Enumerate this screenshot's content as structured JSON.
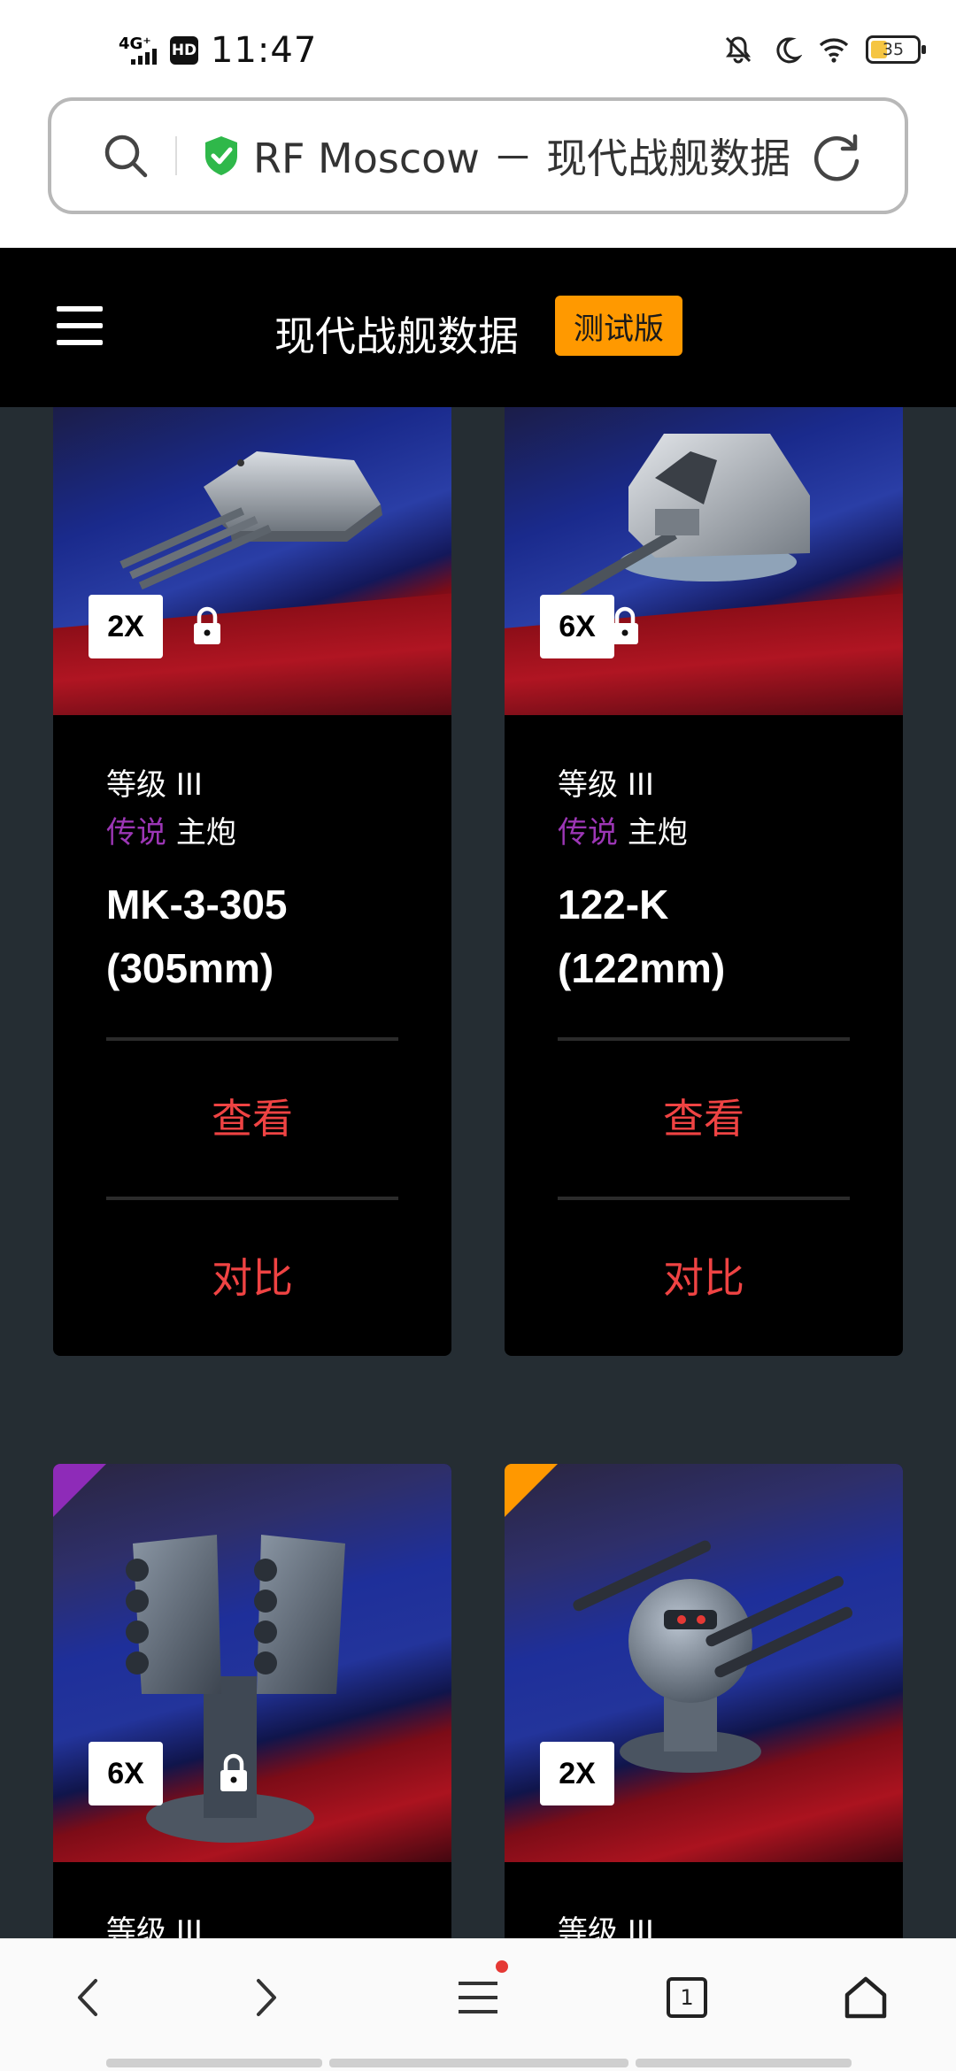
{
  "status_bar": {
    "network": "4G⁺",
    "hd": "HD",
    "time": "11:47",
    "battery": "35"
  },
  "address_bar": {
    "url_text": "RF Moscow － 现代战舰数据",
    "icons": [
      "search-icon",
      "shield-check-icon",
      "reload-icon"
    ]
  },
  "site_header": {
    "title": "现代战舰数据",
    "badge": "测试版"
  },
  "cards": [
    {
      "multiplier": "2X",
      "locked": true,
      "tier": "等级 III",
      "rarity": "传说",
      "weapon_type": "主炮",
      "name_line1": "MK-3-305",
      "name_line2": "(305mm)",
      "view_label": "查看",
      "compare_label": "对比"
    },
    {
      "multiplier": "6X",
      "locked": true,
      "tier": "等级 III",
      "rarity": "传说",
      "weapon_type": "主炮",
      "name_line1": "122-K",
      "name_line2": "(122mm)",
      "view_label": "查看",
      "compare_label": "对比"
    },
    {
      "multiplier": "6X",
      "locked": true,
      "tier": "等级 III",
      "corner_color": "#8e2bb8"
    },
    {
      "multiplier": "2X",
      "locked": false,
      "tier": "等级 III",
      "corner_color": "#ff9800"
    }
  ],
  "colors": {
    "accent_orange": "#ff9900",
    "legendary_purple": "#9c36b5",
    "action_red": "#ef4343",
    "page_bg": "#252d33"
  },
  "bottom_nav": {
    "tab_count": "1",
    "items": [
      "back-icon",
      "forward-icon",
      "menu-icon",
      "tabs-icon",
      "home-icon"
    ]
  }
}
